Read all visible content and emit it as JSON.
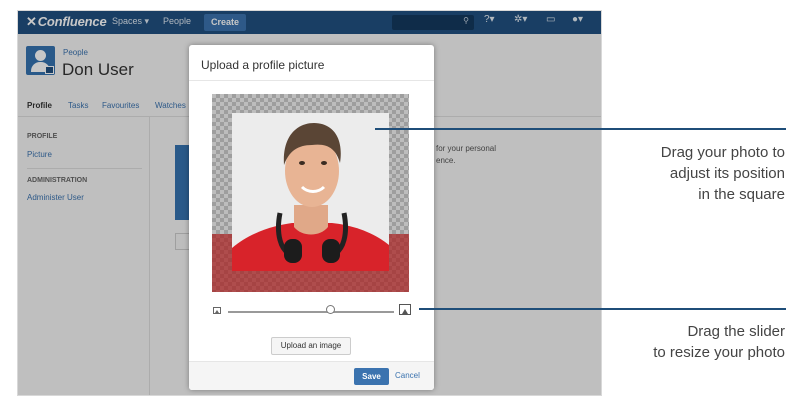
{
  "nav": {
    "logo": "Confluence",
    "spaces": "Spaces ▾",
    "people": "People",
    "create": "Create",
    "search_icon": "search-icon",
    "help_icon": "help-icon",
    "settings_icon": "gear-icon",
    "notifications_icon": "notifications-icon",
    "user_icon": "user-icon"
  },
  "profile": {
    "breadcrumb": "People",
    "name": "Don User"
  },
  "tabs": [
    "Profile",
    "Tasks",
    "Favourites",
    "Watches"
  ],
  "sidebar": {
    "profile_heading": "PROFILE",
    "picture_link": "Picture",
    "admin_heading": "ADMINISTRATION",
    "administer_link": "Administer User"
  },
  "background_text": {
    "line1": "for your personal",
    "line2": "ence."
  },
  "dialog": {
    "title": "Upload a profile picture",
    "upload_button": "Upload an image",
    "save_button": "Save",
    "cancel_link": "Cancel",
    "zoom_level": 0.62
  },
  "callouts": {
    "photo_line1": "Drag your photo to",
    "photo_line2": "adjust its position",
    "photo_line3": "in the square",
    "slider_line1": "Drag the slider",
    "slider_line2": "to resize your photo",
    "line_color": "#1f4e79"
  },
  "colors": {
    "nav_bg": "#205081",
    "accent": "#3b73af",
    "shirt": "#d8232a"
  }
}
